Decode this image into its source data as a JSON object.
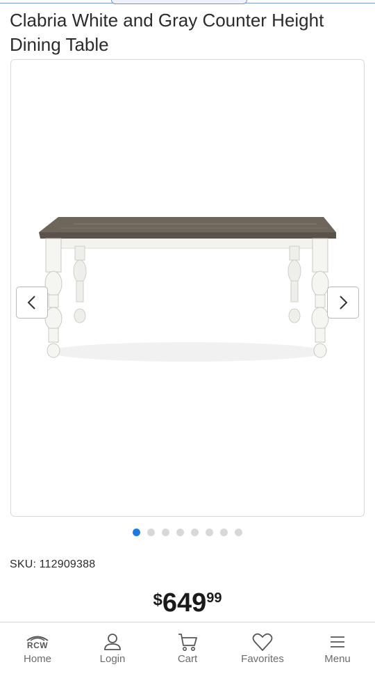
{
  "product": {
    "title": "Clabria White and Gray Counter Height Dining Table",
    "sku_label": "SKU:",
    "sku_value": "112909388"
  },
  "gallery": {
    "image_count": 8,
    "active_index": 0,
    "prev_icon": "chevron-left-icon",
    "next_icon": "chevron-right-icon"
  },
  "price": {
    "currency": "$",
    "dollars": "649",
    "cents": "99"
  },
  "bottom_nav": {
    "items": [
      {
        "label": "Home",
        "icon": "rcw-logo-icon",
        "logo_text": "RCW"
      },
      {
        "label": "Login",
        "icon": "user-icon"
      },
      {
        "label": "Cart",
        "icon": "cart-icon"
      },
      {
        "label": "Favorites",
        "icon": "heart-icon"
      },
      {
        "label": "Menu",
        "icon": "hamburger-icon"
      }
    ]
  },
  "colors": {
    "accent": "#1f7ae0",
    "dot_inactive": "#d8d8d8",
    "text": "#2b2b2b",
    "nav_label": "#6b6b6b"
  }
}
